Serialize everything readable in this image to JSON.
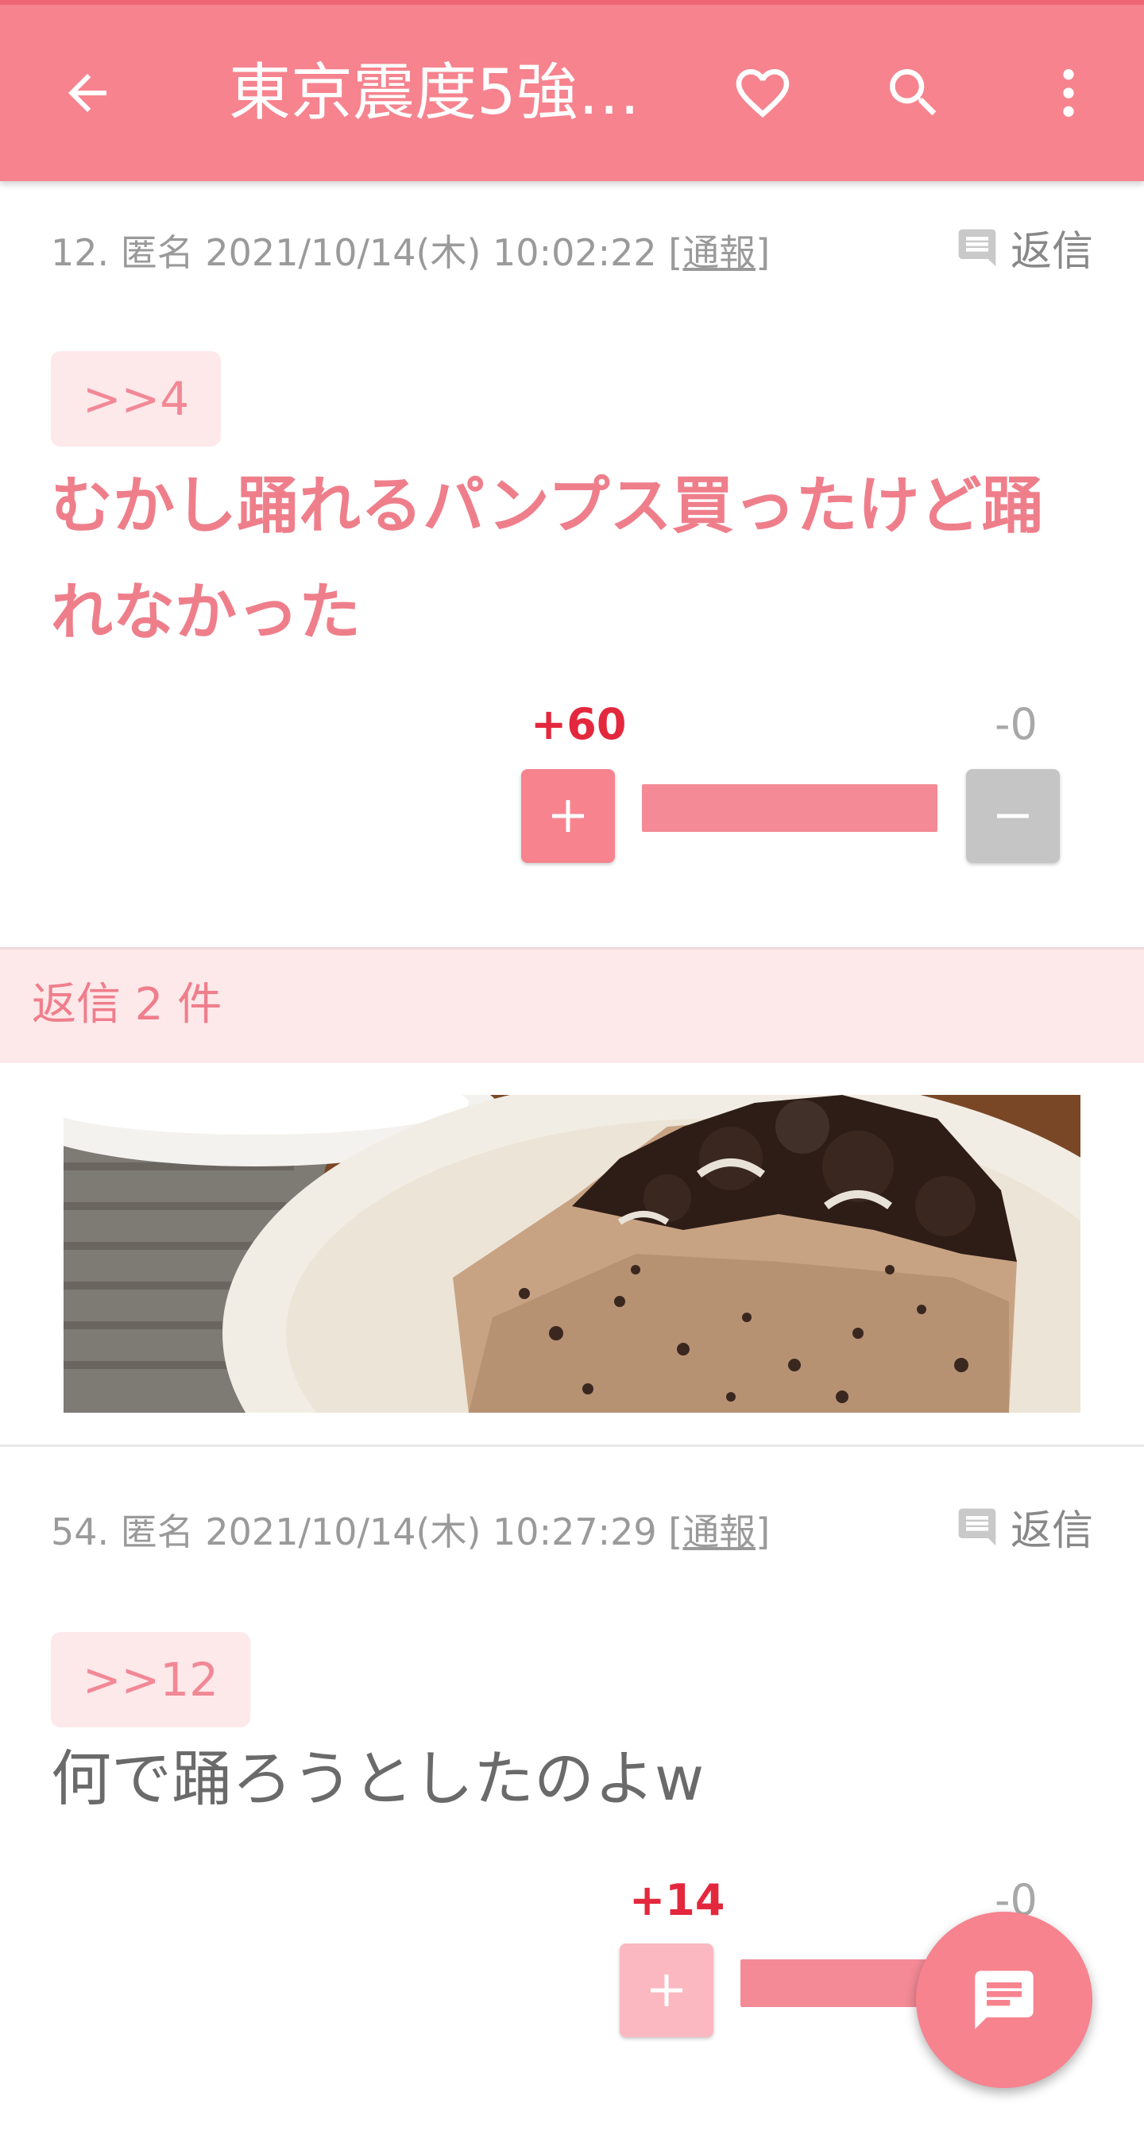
{
  "appbar": {
    "title": "東京震度5強…",
    "icons": [
      "back-arrow-icon",
      "heart-icon",
      "search-icon",
      "more-vert-icon"
    ]
  },
  "comments": [
    {
      "meta": "12. 匿名 2021/10/14(木) 10:02:22",
      "report": "[通報]",
      "reply_label": "返信",
      "anchor": ">>4",
      "body": "むかし踊れるパンプス買ったけど踊れなかった",
      "plus": "+60",
      "minus": "-0"
    },
    {
      "meta": "54. 匿名 2021/10/14(木) 10:27:29",
      "report": "[通報]",
      "reply_label": "返信",
      "anchor": ">>12",
      "body": "何で踊ろうとしたのよw",
      "plus": "+14",
      "minus": "-0"
    }
  ],
  "replies_bar": {
    "label": "返信 2 件"
  },
  "photo": {
    "subject": "oreo-cheesecake-slice"
  },
  "colors": {
    "accent": "#f6838e",
    "accent_dark": "#ee6675",
    "pink_text": "#ef7e8b",
    "plus_red": "#e3283d",
    "pale_pink": "#fde8ea"
  }
}
